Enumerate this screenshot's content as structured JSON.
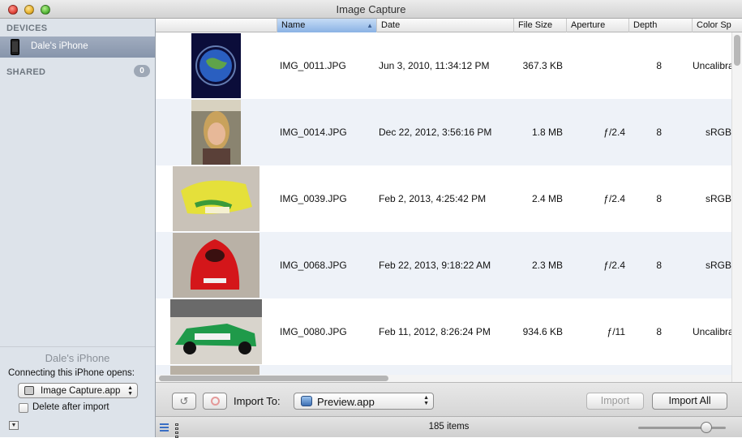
{
  "window": {
    "title": "Image Capture"
  },
  "sidebar": {
    "devices_heading": "DEVICES",
    "device_name": "Dale's iPhone",
    "shared_heading": "SHARED",
    "shared_count": "0",
    "bottom": {
      "device_name": "Dale's iPhone",
      "connecting_label": "Connecting this iPhone opens:",
      "opens_app": "Image Capture.app",
      "delete_after_import_label": "Delete after import",
      "delete_after_import_checked": false
    }
  },
  "table": {
    "columns": [
      "Name",
      "Date",
      "File Size",
      "Aperture",
      "Depth",
      "Color Sp"
    ],
    "sorted_column": "Name",
    "rows": [
      {
        "name": "IMG_0011.JPG",
        "date": "Jun 3, 2010, 11:34:12 PM",
        "size": "367.3 KB",
        "aperture": "",
        "depth": "8",
        "color": "Uncalibra",
        "thumb": "earth-icon"
      },
      {
        "name": "IMG_0014.JPG",
        "date": "Dec 22, 2012, 3:56:16 PM",
        "size": "1.8 MB",
        "aperture": "ƒ/2.4",
        "depth": "8",
        "color": "sRGB",
        "thumb": "portrait-photo"
      },
      {
        "name": "IMG_0039.JPG",
        "date": "Feb 2, 2013, 4:25:42 PM",
        "size": "2.4 MB",
        "aperture": "ƒ/2.4",
        "depth": "8",
        "color": "sRGB",
        "thumb": "yellow-body-photo"
      },
      {
        "name": "IMG_0068.JPG",
        "date": "Feb 22, 2013, 9:18:22 AM",
        "size": "2.3 MB",
        "aperture": "ƒ/2.4",
        "depth": "8",
        "color": "sRGB",
        "thumb": "red-car-photo"
      },
      {
        "name": "IMG_0080.JPG",
        "date": "Feb 11, 2012, 8:26:24 PM",
        "size": "934.6 KB",
        "aperture": "ƒ/11",
        "depth": "8",
        "color": "Uncalibra",
        "thumb": "race-car-photo"
      }
    ]
  },
  "import_bar": {
    "import_to_label": "Import To:",
    "import_to_app": "Preview.app",
    "import_label": "Import",
    "import_all_label": "Import All"
  },
  "status": {
    "item_count": "185 items"
  },
  "colors": {
    "selection": "#8795ab",
    "sorted_header": "#8ab2e4",
    "row_alt": "#eef2f8"
  }
}
